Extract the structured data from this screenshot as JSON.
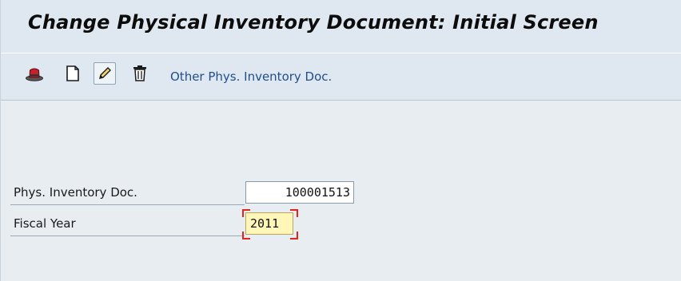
{
  "window": {
    "title": "Change Physical Inventory Document: Initial Screen"
  },
  "toolbar": {
    "buttons": [
      {
        "icon": "display-hat-icon",
        "tooltip": "Display"
      },
      {
        "icon": "new-document-icon",
        "tooltip": "Create"
      },
      {
        "icon": "pencil-icon",
        "tooltip": "Change",
        "active": true
      },
      {
        "icon": "trash-icon",
        "tooltip": "Delete"
      }
    ],
    "other_doc_label": "Other Phys. Inventory Doc."
  },
  "form": {
    "phys_inv_doc": {
      "label": "Phys. Inventory Doc.",
      "value": "100001513"
    },
    "fiscal_year": {
      "label": "Fiscal Year",
      "value": "2011"
    }
  },
  "colors": {
    "title_bar_bg": "#dfe8f0",
    "link_text": "#1f4e8c",
    "focused_field_bg": "#fff6b8",
    "focus_marker": "#e3231c"
  }
}
